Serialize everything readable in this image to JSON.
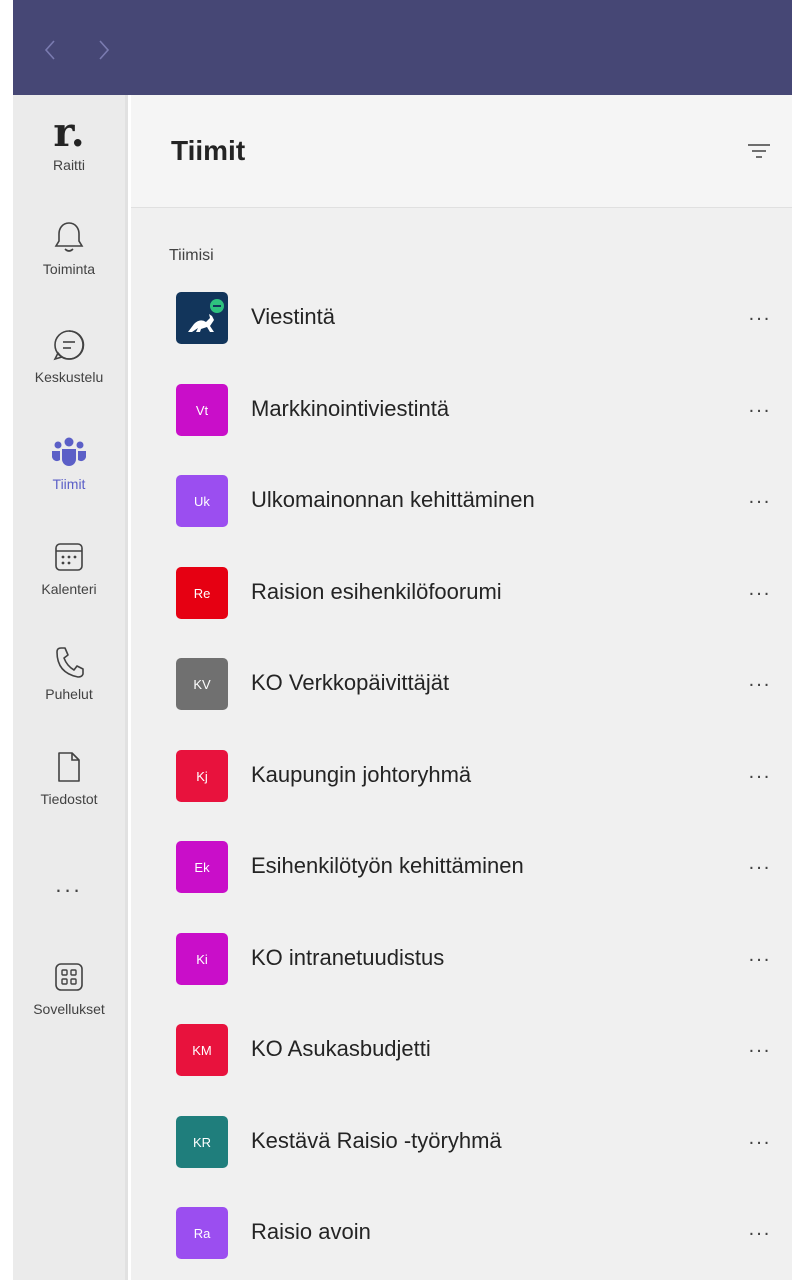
{
  "nav": {
    "back_icon": "chevron-left-icon",
    "forward_icon": "chevron-right-icon"
  },
  "rail": {
    "app": {
      "logo": "r.",
      "label": "Raitti"
    },
    "items": [
      {
        "label": "Toiminta",
        "icon": "bell-icon"
      },
      {
        "label": "Keskustelu",
        "icon": "chat-icon"
      },
      {
        "label": "Tiimit",
        "icon": "teams-icon",
        "active": true
      },
      {
        "label": "Kalenteri",
        "icon": "calendar-icon"
      },
      {
        "label": "Puhelut",
        "icon": "phone-icon"
      },
      {
        "label": "Tiedostot",
        "icon": "file-icon"
      }
    ],
    "more": "...",
    "apps": {
      "label": "Sovellukset",
      "icon": "apps-grid-icon"
    }
  },
  "header": {
    "title": "Tiimit",
    "filter_icon": "filter-icon"
  },
  "section": {
    "title": "Tiimisi"
  },
  "teams": [
    {
      "name": "Viestintä",
      "initials": "",
      "color": "#12355b",
      "more": "..."
    },
    {
      "name": "Markkinointiviestintä",
      "initials": "Vt",
      "color": "#c90ec9",
      "more": "..."
    },
    {
      "name": "Ulkomainonnan kehittäminen",
      "initials": "Uk",
      "color": "#9b4ef0",
      "more": "..."
    },
    {
      "name": "Raision esihenkilöfoorumi",
      "initials": "Re",
      "color": "#e60012",
      "more": "..."
    },
    {
      "name": "KO Verkkopäivittäjät",
      "initials": "KV",
      "color": "#707070",
      "more": "..."
    },
    {
      "name": "Kaupungin johtoryhmä",
      "initials": "Kj",
      "color": "#e8123d",
      "more": "..."
    },
    {
      "name": "Esihenkilötyön kehittäminen",
      "initials": "Ek",
      "color": "#c90ec9",
      "more": "..."
    },
    {
      "name": "KO intranetuudistus",
      "initials": "Ki",
      "color": "#c90ec9",
      "more": "..."
    },
    {
      "name": "KO Asukasbudjetti",
      "initials": "KM",
      "color": "#e8123d",
      "more": "..."
    },
    {
      "name": "Kestävä Raisio -työryhmä",
      "initials": "KR",
      "color": "#1f7e7c",
      "more": "..."
    },
    {
      "name": "Raisio avoin",
      "initials": "Ra",
      "color": "#9b4ef0",
      "more": "..."
    }
  ]
}
